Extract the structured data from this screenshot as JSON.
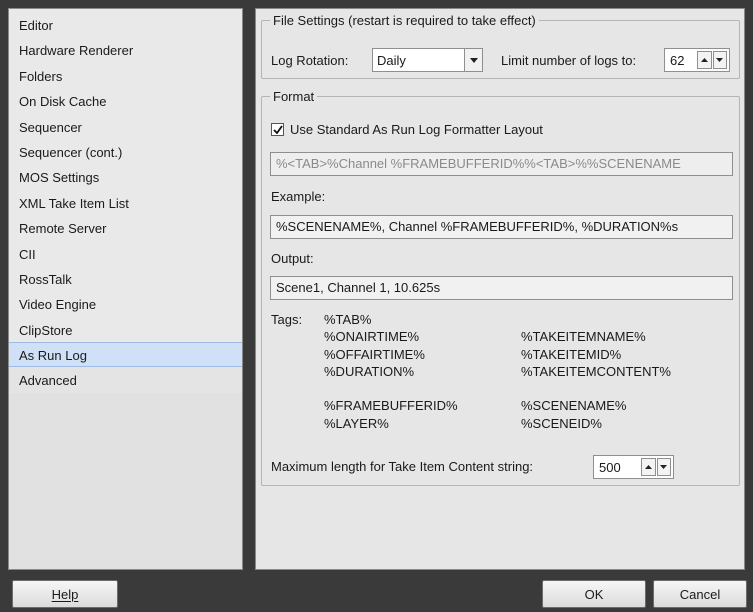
{
  "sidebar": {
    "items": [
      {
        "label": "Editor"
      },
      {
        "label": "Hardware Renderer"
      },
      {
        "label": "Folders"
      },
      {
        "label": "On Disk Cache"
      },
      {
        "label": "Sequencer"
      },
      {
        "label": "Sequencer (cont.)"
      },
      {
        "label": "MOS Settings"
      },
      {
        "label": "XML Take Item List"
      },
      {
        "label": "Remote Server"
      },
      {
        "label": "CII"
      },
      {
        "label": "RossTalk"
      },
      {
        "label": "Video Engine"
      },
      {
        "label": "ClipStore"
      },
      {
        "label": "As Run Log"
      },
      {
        "label": "Advanced"
      }
    ],
    "selected": "As Run Log"
  },
  "file_settings": {
    "title": "File Settings (restart is required to take effect)",
    "log_rotation_label": "Log Rotation:",
    "log_rotation_value": "Daily",
    "limit_label": "Limit number of logs to:",
    "limit_value": "62"
  },
  "format": {
    "title": "Format",
    "use_standard_label": "Use Standard As Run Log Formatter Layout",
    "use_standard_checked": true,
    "format_string": "%<TAB>%Channel %FRAMEBUFFERID%%<TAB>%%SCENENAME",
    "example_label": "Example:",
    "example_value": "%SCENENAME%, Channel %FRAMEBUFFERID%, %DURATION%s",
    "output_label": "Output:",
    "output_value": "Scene1, Channel 1, 10.625s",
    "tags_label": "Tags:",
    "tags": {
      "tab": "%TAB%",
      "onairtime": "%ONAIRTIME%",
      "offairtime": "%OFFAIRTIME%",
      "duration": "%DURATION%",
      "framebufferid": "%FRAMEBUFFERID%",
      "layer": "%LAYER%",
      "takeitemname": "%TAKEITEMNAME%",
      "takeitemid": "%TAKEITEMID%",
      "takeitemcontent": "%TAKEITEMCONTENT%",
      "scenename": "%SCENENAME%",
      "sceneid": "%SCENEID%"
    },
    "max_length_label": "Maximum length for Take Item Content string:",
    "max_length_value": "500"
  },
  "buttons": {
    "help": "Help",
    "ok": "OK",
    "cancel": "Cancel"
  }
}
